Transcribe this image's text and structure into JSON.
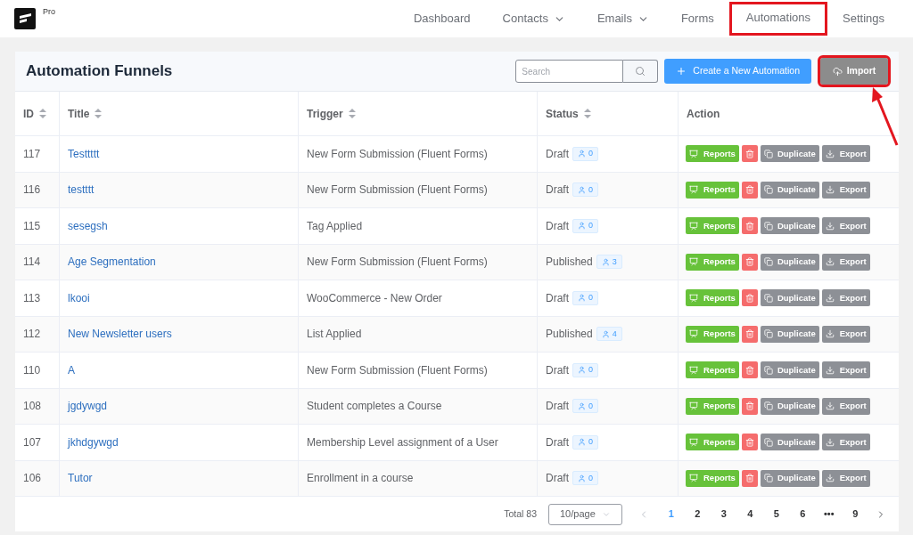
{
  "brand": {
    "badge": "Pro"
  },
  "nav": [
    {
      "label": "Dashboard",
      "dropdown": false,
      "selected": false,
      "highlighted": false
    },
    {
      "label": "Contacts",
      "dropdown": true,
      "selected": false,
      "highlighted": false
    },
    {
      "label": "Emails",
      "dropdown": true,
      "selected": false,
      "highlighted": false
    },
    {
      "label": "Forms",
      "dropdown": false,
      "selected": false,
      "highlighted": false
    },
    {
      "label": "Automations",
      "dropdown": false,
      "selected": true,
      "highlighted": true
    },
    {
      "label": "Settings",
      "dropdown": false,
      "selected": false,
      "highlighted": false
    }
  ],
  "page": {
    "title": "Automation Funnels",
    "search": {
      "placeholder": "Search"
    },
    "create_button": "Create a New Automation",
    "import_button": {
      "label": "Import",
      "highlighted": true
    }
  },
  "table": {
    "columns": [
      {
        "label": "ID",
        "sortable": true
      },
      {
        "label": "Title",
        "sortable": true
      },
      {
        "label": "Trigger",
        "sortable": true
      },
      {
        "label": "Status",
        "sortable": true
      },
      {
        "label": "Action",
        "sortable": false
      }
    ],
    "rows": [
      {
        "id": "117",
        "title": "Testtttt",
        "trigger": "New Form Submission (Fluent Forms)",
        "status": "Draft",
        "count": "0",
        "reports": "Reports",
        "duplicate": "Duplicate",
        "export": "Export"
      },
      {
        "id": "116",
        "title": "testttt",
        "trigger": "New Form Submission (Fluent Forms)",
        "status": "Draft",
        "count": "0",
        "reports": "Reports",
        "duplicate": "Duplicate",
        "export": "Export"
      },
      {
        "id": "115",
        "title": "sesegsh",
        "trigger": "Tag Applied",
        "status": "Draft",
        "count": "0",
        "reports": "Reports",
        "duplicate": "Duplicate",
        "export": "Export"
      },
      {
        "id": "114",
        "title": "Age Segmentation",
        "trigger": "New Form Submission (Fluent Forms)",
        "status": "Published",
        "count": "3",
        "reports": "Reports",
        "duplicate": "Duplicate",
        "export": "Export"
      },
      {
        "id": "113",
        "title": "lkooi",
        "trigger": "WooCommerce - New Order",
        "status": "Draft",
        "count": "0",
        "reports": "Reports",
        "duplicate": "Duplicate",
        "export": "Export"
      },
      {
        "id": "112",
        "title": "New Newsletter users",
        "trigger": "List Applied",
        "status": "Published",
        "count": "4",
        "reports": "Reports",
        "duplicate": "Duplicate",
        "export": "Export"
      },
      {
        "id": "110",
        "title": "A",
        "trigger": "New Form Submission (Fluent Forms)",
        "status": "Draft",
        "count": "0",
        "reports": "Reports",
        "duplicate": "Duplicate",
        "export": "Export"
      },
      {
        "id": "108",
        "title": "jgdywgd",
        "trigger": "Student completes a Course",
        "status": "Draft",
        "count": "0",
        "reports": "Reports",
        "duplicate": "Duplicate",
        "export": "Export"
      },
      {
        "id": "107",
        "title": "jkhdgywgd",
        "trigger": "Membership Level assignment of a User",
        "status": "Draft",
        "count": "0",
        "reports": "Reports",
        "duplicate": "Duplicate",
        "export": "Export"
      },
      {
        "id": "106",
        "title": "Tutor",
        "trigger": "Enrollment in a course",
        "status": "Draft",
        "count": "0",
        "reports": "Reports",
        "duplicate": "Duplicate",
        "export": "Export"
      }
    ]
  },
  "pagination": {
    "total": "Total 83",
    "page_size": "10/page",
    "pages": [
      {
        "label": "1",
        "selected": true
      },
      {
        "label": "2",
        "selected": false
      },
      {
        "label": "3",
        "selected": false
      },
      {
        "label": "4",
        "selected": false
      },
      {
        "label": "5",
        "selected": false
      },
      {
        "label": "6",
        "selected": false
      },
      {
        "label": "•••",
        "selected": false
      },
      {
        "label": "9",
        "selected": false
      }
    ]
  }
}
